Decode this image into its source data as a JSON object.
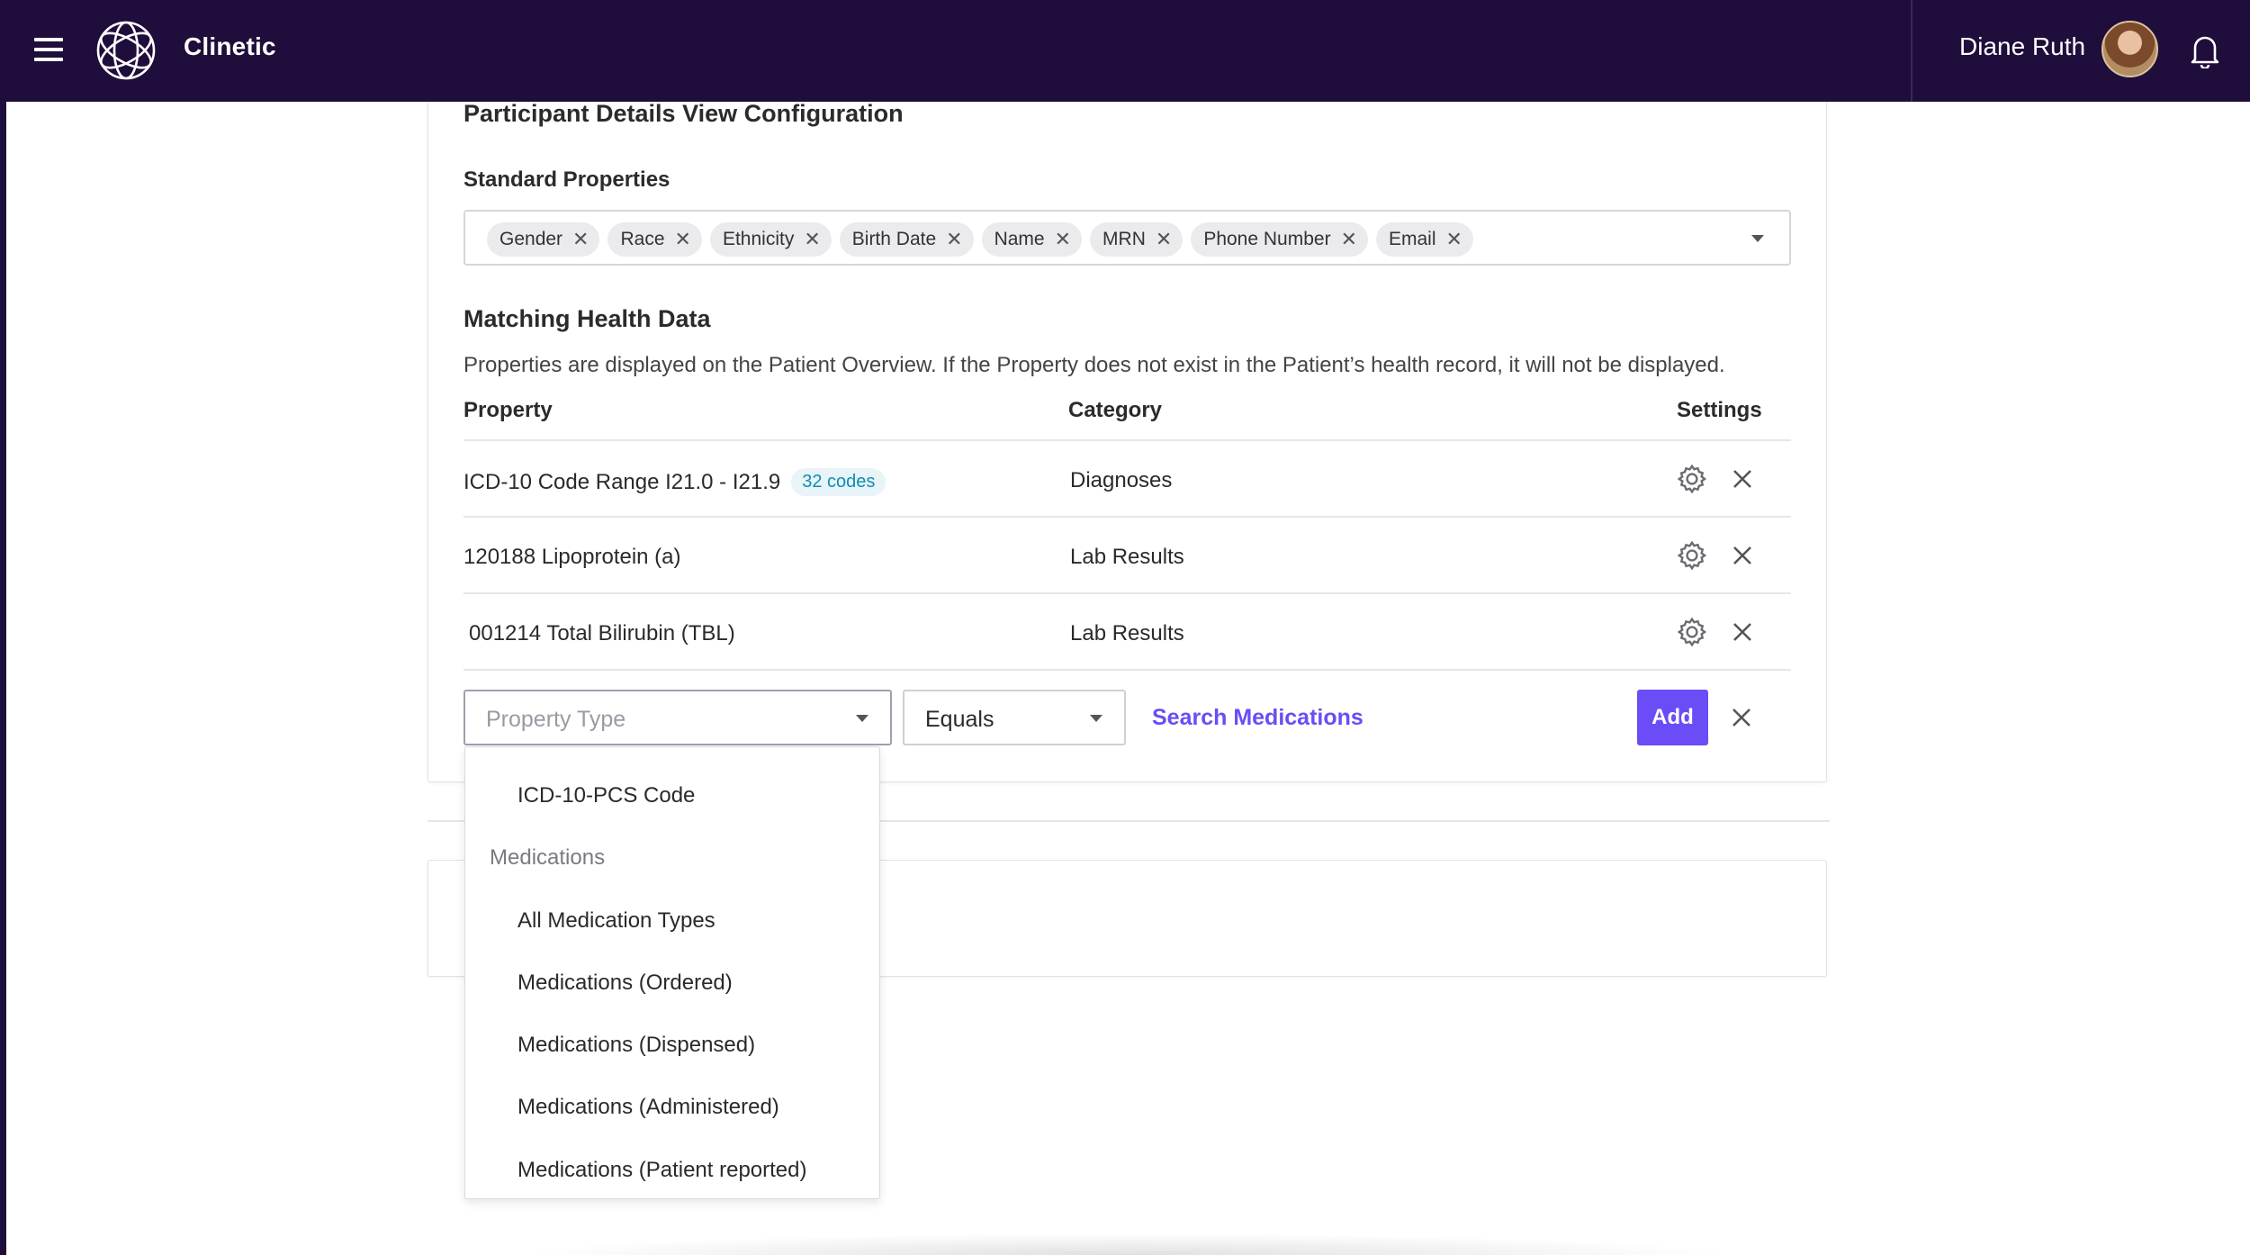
{
  "app": {
    "name": "Clinetic"
  },
  "user": {
    "name": "Diane Ruth"
  },
  "config": {
    "heading": "Participant Details View Configuration",
    "standard_label": "Standard Properties",
    "chips": [
      "Gender",
      "Race",
      "Ethnicity",
      "Birth Date",
      "Name",
      "MRN",
      "Phone Number",
      "Email"
    ]
  },
  "matching": {
    "heading": "Matching Health Data",
    "description": "Properties are displayed on the Patient Overview. If the Property does not exist in the Patient’s health record, it will not be displayed.",
    "columns": {
      "property": "Property",
      "category": "Category",
      "settings": "Settings"
    },
    "rows": [
      {
        "property": "ICD-10 Code Range I21.0 - I21.9",
        "badge": "32 codes",
        "category": "Diagnoses"
      },
      {
        "property": "120188 Lipoprotein (a)",
        "category": "Lab Results"
      },
      {
        "property": "001214 Total Bilirubin (TBL)",
        "category": "Lab Results"
      }
    ]
  },
  "add_row": {
    "property_type_placeholder": "Property Type",
    "operator": "Equals",
    "search_link": "Search Medications",
    "add_label": "Add"
  },
  "dropdown": {
    "items_top": [
      "ICD-10-PCS Code"
    ],
    "group_label": "Medications",
    "items": [
      "All Medication Types",
      "Medications (Ordered)",
      "Medications (Dispensed)",
      "Medications (Administered)",
      "Medications (Patient reported)"
    ]
  },
  "colors": {
    "topbar": "#1f0d3b",
    "accent": "#6c4cf6",
    "badge_text": "#0c8fb0"
  },
  "icons": [
    "menu-icon",
    "logo-icon",
    "bell-icon",
    "gear-icon",
    "close-icon",
    "chevron-down-icon"
  ]
}
